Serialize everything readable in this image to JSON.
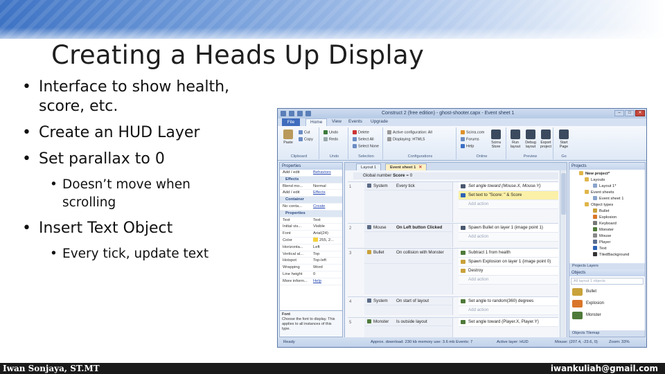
{
  "slide": {
    "title": "Creating a Heads Up Display",
    "bullets": [
      {
        "text": "Interface to show health,\nscore, etc.",
        "level": 1
      },
      {
        "text": "Create an HUD Layer",
        "level": 1
      },
      {
        "text": "Set parallax to 0",
        "level": 1
      },
      {
        "text": "Doesn’t move when\nscrolling",
        "level": 2
      },
      {
        "text": "Insert Text Object",
        "level": 1
      },
      {
        "text": "Every tick, update text",
        "level": 2
      }
    ],
    "bullet_glyph": "•",
    "footer_left": "Iwan Sonjaya, ST.MT",
    "footer_right": "iwankuliah@gmail.com",
    "colors": {
      "band": "#3e73c4",
      "footer": "#1a1a1a"
    }
  },
  "app": {
    "window_title": "Construct 2 (free edition) - ghost-shooter.capx - Event sheet 1",
    "menu_tabs": [
      "File",
      "Home",
      "View",
      "Events",
      "Upgrade"
    ],
    "ribbon": {
      "paste": "Paste",
      "cut": "Cut",
      "copy": "Copy",
      "clipboard": "Clipboard",
      "undo": "Undo",
      "redo": "Redo",
      "undo_group": "Undo",
      "delete": "Delete",
      "select_all": "Select All",
      "select_none": "Select None",
      "selection": "Selection",
      "active_config": "Active configuration: All",
      "displaying": "Displaying: HTML5",
      "configurations": "Configurations",
      "scirra": "Scirra.com",
      "forums": "Forums",
      "help": "Help",
      "online": "Online",
      "store": "Scirra Store",
      "run": "Run layout",
      "debug": "Debug layout",
      "export": "Export project",
      "start": "Start Page",
      "preview": "Preview",
      "go": "Go"
    },
    "properties": {
      "header": "Properties",
      "rows": [
        {
          "k": "Add / edit",
          "v": "Behaviors",
          "link": true
        },
        {
          "cat": "Effects"
        },
        {
          "k": "Blend mo...",
          "v": "Normal"
        },
        {
          "k": "Add / edit",
          "v": "Effects",
          "link": true
        },
        {
          "cat": "Container"
        },
        {
          "k": "No conta...",
          "v": "Create",
          "link": true
        },
        {
          "cat": "Properties"
        },
        {
          "k": "Text",
          "v": "Text"
        },
        {
          "k": "Initial vis...",
          "v": "Visible"
        },
        {
          "k": "Font",
          "v": "Arial(24)"
        },
        {
          "k": "Color",
          "v": "255, 2..."
        },
        {
          "k": "Horizonta...",
          "v": "Left"
        },
        {
          "k": "Vertical al...",
          "v": "Top"
        },
        {
          "k": "Hotspot",
          "v": "Top-left"
        },
        {
          "k": "Wrapping",
          "v": "Word"
        },
        {
          "k": "Line height",
          "v": "0"
        },
        {
          "k": "More inform...",
          "v": "Help",
          "link": true
        }
      ],
      "tip_title": "Font",
      "tip_text": "Choose the font to display. This applies to all instances of this type."
    },
    "doc_tabs": [
      {
        "label": "Layout 1",
        "active": false
      },
      {
        "label": "Event sheet 1",
        "active": true
      }
    ],
    "global_var": {
      "prefix": "Global number",
      "name": "Score",
      "suffix": "= 0"
    },
    "events": [
      {
        "num": "1",
        "conds": [
          {
            "obj": "System",
            "text": "Every tick"
          }
        ],
        "actions": [
          {
            "text": "Set angle toward (Mouse.X, Mouse.Y)",
            "hl": false
          },
          {
            "text": "Set text to \"Score: \" & Score",
            "hl": true
          },
          {
            "text": "Add action",
            "add": true
          }
        ]
      },
      {
        "num": "2",
        "conds": [
          {
            "obj": "Mouse",
            "text": "On Left button Clicked"
          }
        ],
        "actions": [
          {
            "text": "Spawn Bullet on layer 1 (image point 1)",
            "hl": false
          },
          {
            "text": "Add action",
            "add": true
          }
        ]
      },
      {
        "num": "3",
        "conds": [
          {
            "obj": "Bullet",
            "text": "On collision with Monster"
          }
        ],
        "actions": [
          {
            "text": "Subtract 1 from health",
            "hl": false
          },
          {
            "text": "Spawn Explosion on layer 1 (image point 0)",
            "hl": false
          },
          {
            "text": "Destroy",
            "hl": false
          },
          {
            "text": "Add action",
            "add": true
          }
        ]
      },
      {
        "num": "4",
        "conds": [
          {
            "obj": "System",
            "text": "On start of layout"
          }
        ],
        "actions": [
          {
            "text": "Set angle to random(360) degrees",
            "hl": false
          },
          {
            "text": "Add action",
            "add": true
          }
        ]
      },
      {
        "num": "5",
        "conds": [
          {
            "obj": "Monster",
            "text": "Is outside layout"
          }
        ],
        "actions": [
          {
            "text": "Set angle toward (Player.X, Player.Y)",
            "hl": false
          }
        ]
      }
    ],
    "projects": {
      "header": "Projects",
      "tree": [
        {
          "label": "New project*",
          "depth": 0,
          "folder": true
        },
        {
          "label": "Layouts",
          "depth": 1,
          "folder": true
        },
        {
          "label": "Layout 1*",
          "depth": 2
        },
        {
          "label": "Event sheets",
          "depth": 1,
          "folder": true
        },
        {
          "label": "Event sheet 1",
          "depth": 2
        },
        {
          "label": "Object types",
          "depth": 1,
          "folder": true
        },
        {
          "label": "Bullet",
          "depth": 2
        },
        {
          "label": "Explosion",
          "depth": 2
        },
        {
          "label": "Keyboard",
          "depth": 2
        },
        {
          "label": "Monster",
          "depth": 2
        },
        {
          "label": "Mouse",
          "depth": 2
        },
        {
          "label": "Player",
          "depth": 2
        },
        {
          "label": "Text",
          "depth": 2
        },
        {
          "label": "TiledBackground",
          "depth": 2
        }
      ],
      "tabs": "Projects   Layers"
    },
    "objects": {
      "header": "Objects",
      "filter": "All layout 1 objects",
      "items": [
        {
          "label": "Bullet",
          "color": "#c9a23a"
        },
        {
          "label": "Explosion",
          "color": "#d9762a"
        },
        {
          "label": "Monster",
          "color": "#4f7a3a"
        }
      ],
      "tabs": "Objects   Tilemap"
    },
    "status": {
      "ready": "Ready",
      "download": "Approx. download: 230 kb  memory use: 3.6 mb  Events: 7",
      "layer": "Active layer: HUD",
      "mouse": "Mouse: (207.4, -23.6, 0)",
      "zoom": "Zoom: 33%"
    },
    "titlebar_buttons": [
      "–",
      "□",
      "✕"
    ]
  }
}
